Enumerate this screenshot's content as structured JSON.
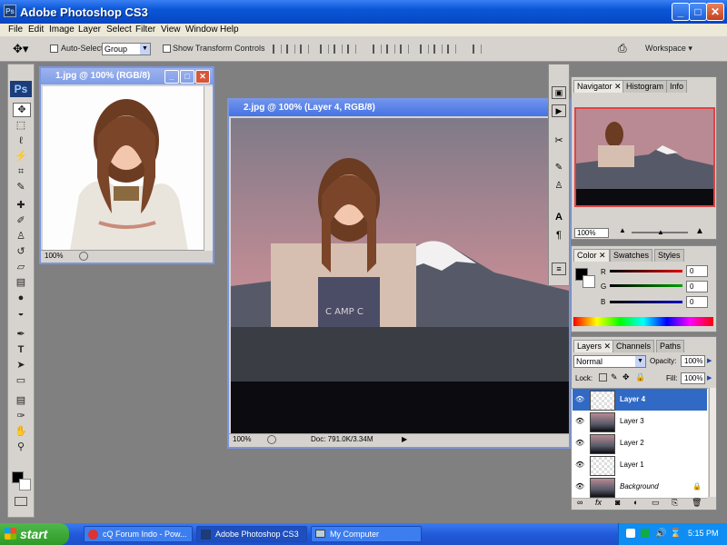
{
  "app": {
    "title": "Adobe Photoshop CS3",
    "icon": "ps-icon",
    "window_controls": [
      "minimize",
      "maximize",
      "close"
    ]
  },
  "menu": [
    "File",
    "Edit",
    "Image",
    "Layer",
    "Select",
    "Filter",
    "View",
    "Window",
    "Help"
  ],
  "options_bar": {
    "auto_select_label": "Auto-Select:",
    "auto_select_value": "Group",
    "show_transform_label": "Show Transform Controls",
    "workspace_label": "Workspace ▾"
  },
  "tools": [
    "move",
    "marquee",
    "lasso",
    "magic-wand",
    "crop",
    "slice",
    "healing-brush",
    "brush",
    "clone-stamp",
    "history-brush",
    "eraser",
    "gradient",
    "blur",
    "dodge",
    "pen",
    "type",
    "path-select",
    "shape",
    "notes",
    "eyedropper",
    "hand",
    "zoom"
  ],
  "ps_logo": "Ps",
  "documents": [
    {
      "title": "1.jpg @ 100% (RGB/8)",
      "zoom": "100%",
      "state": "inactive"
    },
    {
      "title": "2.jpg @ 100% (Layer 4, RGB/8)",
      "zoom": "100%",
      "doc_info": "Doc: 791.0K/3.34M",
      "state": "active"
    }
  ],
  "navigator": {
    "tabs": [
      "Navigator",
      "Histogram",
      "Info"
    ],
    "zoom": "100%"
  },
  "color_panel": {
    "tabs": [
      "Color",
      "Swatches",
      "Styles"
    ],
    "channels": [
      {
        "label": "R",
        "value": "0",
        "color": "#e00000"
      },
      {
        "label": "G",
        "value": "0",
        "color": "#00a000"
      },
      {
        "label": "B",
        "value": "0",
        "color": "#0000c0"
      }
    ]
  },
  "layers_panel": {
    "tabs": [
      "Layers",
      "Channels",
      "Paths"
    ],
    "blend_mode": "Normal",
    "opacity_label": "Opacity:",
    "opacity": "100%",
    "lock_label": "Lock:",
    "fill_label": "Fill:",
    "fill": "100%",
    "layers": [
      {
        "name": "Layer 4",
        "selected": true
      },
      {
        "name": "Layer 3",
        "selected": false
      },
      {
        "name": "Layer 2",
        "selected": false
      },
      {
        "name": "Layer 1",
        "selected": false
      },
      {
        "name": "Background",
        "selected": false
      }
    ]
  },
  "taskbar": {
    "start_label": "start",
    "items": [
      {
        "label": "cQ Forum Indo - Pow...",
        "active": false
      },
      {
        "label": "Adobe Photoshop CS3",
        "active": true
      },
      {
        "label": "My Computer",
        "active": false
      }
    ],
    "clock": "5:15 PM"
  },
  "colors": {
    "xp_blue": "#0a56d8",
    "photoshop_gray": "#d6d3ce",
    "selection_blue": "#316ac5",
    "canvas_bg": "#808080"
  }
}
